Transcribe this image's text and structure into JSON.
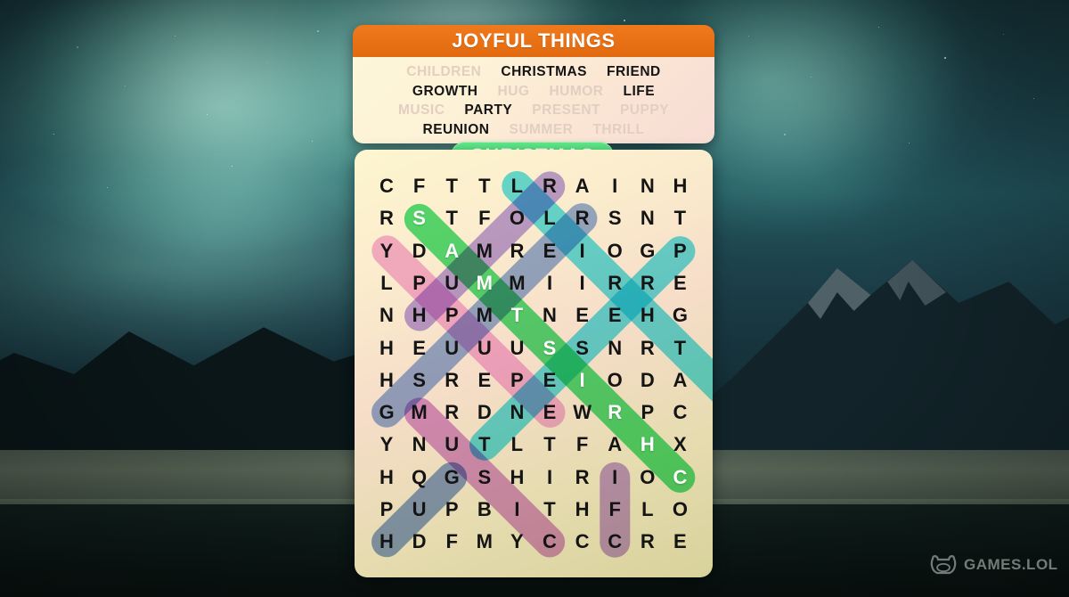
{
  "word_panel": {
    "header_title": "JOYFUL THINGS",
    "header_color": "#e8711a",
    "rows": [
      [
        {
          "label": "CHILDREN",
          "found": true
        },
        {
          "label": "CHRISTMAS",
          "found": false
        },
        {
          "label": "FRIEND",
          "found": false
        }
      ],
      [
        {
          "label": "GROWTH",
          "found": false
        },
        {
          "label": "HUG",
          "found": true
        },
        {
          "label": "HUMOR",
          "found": true
        },
        {
          "label": "LIFE",
          "found": false
        }
      ],
      [
        {
          "label": "MUSIC",
          "found": true
        },
        {
          "label": "PARTY",
          "found": false
        },
        {
          "label": "PRESENT",
          "found": true
        },
        {
          "label": "PUPPY",
          "found": true
        }
      ],
      [
        {
          "label": "REUNION",
          "found": false
        },
        {
          "label": "SUMMER",
          "found": true
        },
        {
          "label": "THRILL",
          "found": true
        }
      ]
    ]
  },
  "current_word_badge": {
    "label": "CHRISTMAS",
    "color": "#4ee07a"
  },
  "grid": {
    "rows": 12,
    "cols": 10,
    "letters": [
      [
        "C",
        "F",
        "T",
        "T",
        "L",
        "R",
        "A",
        "I",
        "N",
        "H"
      ],
      [
        "R",
        "S",
        "T",
        "F",
        "O",
        "L",
        "R",
        "S",
        "N",
        "T"
      ],
      [
        "Y",
        "D",
        "A",
        "M",
        "R",
        "E",
        "I",
        "O",
        "G",
        "P"
      ],
      [
        "L",
        "P",
        "U",
        "M",
        "M",
        "I",
        "I",
        "R",
        "R",
        "E"
      ],
      [
        "N",
        "H",
        "P",
        "M",
        "T",
        "N",
        "E",
        "E",
        "H",
        "G"
      ],
      [
        "H",
        "E",
        "U",
        "U",
        "U",
        "S",
        "S",
        "N",
        "R",
        "T"
      ],
      [
        "H",
        "S",
        "R",
        "E",
        "P",
        "E",
        "I",
        "O",
        "D",
        "A"
      ],
      [
        "G",
        "M",
        "R",
        "D",
        "N",
        "E",
        "W",
        "R",
        "P",
        "C"
      ],
      [
        "Y",
        "N",
        "U",
        "T",
        "L",
        "T",
        "F",
        "A",
        "H",
        "X"
      ],
      [
        "H",
        "Q",
        "G",
        "S",
        "H",
        "I",
        "R",
        "I",
        "O",
        "C"
      ],
      [
        "P",
        "U",
        "P",
        "B",
        "I",
        "T",
        "H",
        "F",
        "L",
        "O"
      ],
      [
        "H",
        "D",
        "F",
        "M",
        "Y",
        "C",
        "C",
        "C",
        "R",
        "E"
      ]
    ],
    "highlighted_cells": [
      {
        "row": 1,
        "col": 1,
        "letter": "S",
        "color": "#4ee07a"
      },
      {
        "row": 2,
        "col": 2,
        "letter": "A",
        "color": "#4ee07a"
      },
      {
        "row": 3,
        "col": 3,
        "letter": "M",
        "color": "#4ee07a"
      },
      {
        "row": 4,
        "col": 4,
        "letter": "T",
        "color": "#4ee07a"
      },
      {
        "row": 5,
        "col": 5,
        "letter": "S",
        "color": "#4ee07a"
      },
      {
        "row": 6,
        "col": 6,
        "letter": "I",
        "color": "#4ee07a"
      },
      {
        "row": 7,
        "col": 7,
        "letter": "R",
        "color": "#4ee07a"
      },
      {
        "row": 8,
        "col": 8,
        "letter": "H",
        "color": "#4ee07a"
      },
      {
        "row": 9,
        "col": 9,
        "letter": "C",
        "color": "#4ee07a"
      }
    ],
    "found_word_paths": [
      {
        "word": "CHRISTMAS",
        "color": "#4ee07a",
        "start": [
          1,
          1
        ],
        "end": [
          9,
          9
        ],
        "active": true
      },
      {
        "word": "SUMMER",
        "color": "#f2a4e4",
        "start": [
          2,
          0
        ],
        "end": [
          7,
          5
        ]
      },
      {
        "word": "HUMOR",
        "color": "#aa8de8",
        "start": [
          0,
          5
        ],
        "end": [
          4,
          1
        ]
      },
      {
        "word": "PRESENT",
        "color": "#7b9ee0",
        "start": [
          1,
          6
        ],
        "end": [
          7,
          0
        ]
      },
      {
        "word": "CHILDREN",
        "color": "#41dbf2",
        "start": [
          0,
          4
        ],
        "end": [
          7,
          11
        ]
      },
      {
        "word": "THRILL",
        "color": "#41dbf2",
        "start": [
          2,
          9
        ],
        "end": [
          8,
          3
        ]
      },
      {
        "word": "MUSIC",
        "color": "#cf82d8",
        "start": [
          7,
          1
        ],
        "end": [
          11,
          5
        ]
      },
      {
        "word": "PUPPY",
        "color": "#6b8fd4",
        "start": [
          9,
          2
        ],
        "end": [
          11,
          0
        ]
      },
      {
        "word": "HUG",
        "color": "#b58ae0",
        "start": [
          9,
          7
        ],
        "end": [
          11,
          7
        ]
      }
    ]
  },
  "watermark": {
    "brand": "GAMES.LOL"
  }
}
